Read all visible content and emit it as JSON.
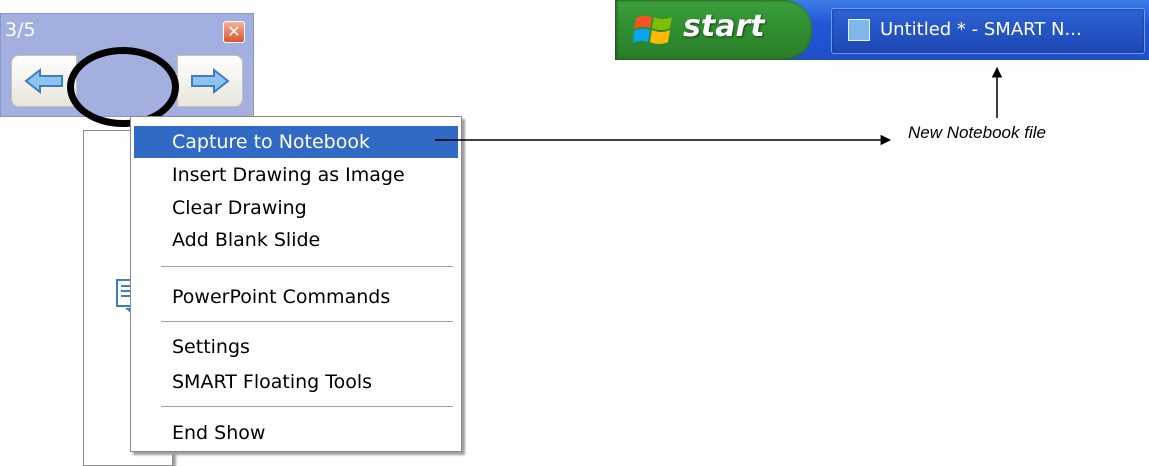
{
  "toolbar": {
    "counter": "3/5",
    "close_glyph": "✕",
    "prev_icon": "arrow-left-icon",
    "menu_icon": "capture-menu-icon",
    "next_icon": "arrow-right-icon"
  },
  "menu": {
    "items": [
      {
        "label": "Capture to Notebook",
        "selected": true
      },
      {
        "label": "Insert Drawing as Image"
      },
      {
        "label": "Clear Drawing"
      },
      {
        "label": "Add Blank Slide"
      },
      {
        "label": "PowerPoint Commands"
      },
      {
        "label": "Settings"
      },
      {
        "label": "SMART Floating Tools"
      },
      {
        "label": "End Show"
      }
    ]
  },
  "taskbar": {
    "start_label": "start",
    "task_label": "Untitled * - SMART N...",
    "start_color": "#2f8e2f",
    "bar_color": "#2157d7"
  },
  "annotation": {
    "label": "New Notebook file"
  },
  "colors": {
    "selection": "#316ac5",
    "toolbar_bg": "#a3b0df"
  }
}
